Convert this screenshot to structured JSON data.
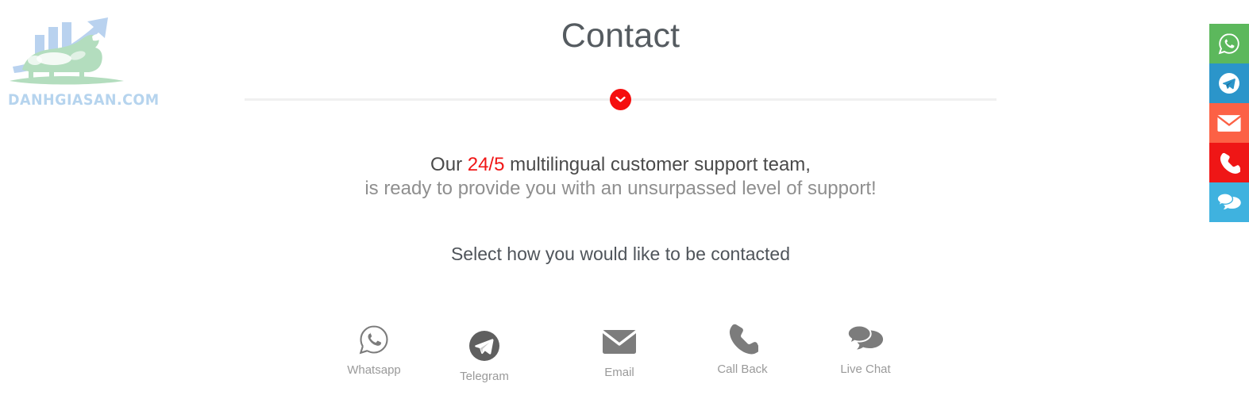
{
  "brand": {
    "logo_text": "DANHGIASAN.COM",
    "logo_icon": "bull-growth-chart-logo",
    "logo_bar_color": "#b9d2ef",
    "logo_bull_color": "#b3ddbe",
    "logo_text_color": "#b6d4ee"
  },
  "header": {
    "title": "Contact",
    "divider_badge_icon": "chevron-down-icon",
    "divider_badge_color": "#f50f0f",
    "divider_line_color": "#f0f0f0"
  },
  "intro": {
    "line1_prefix": "Our ",
    "line1_accent": "24/5",
    "line1_suffix": " multilingual customer support team,",
    "line2": "is ready to provide you with an unsurpassed level of support!",
    "accent_color": "#f01616"
  },
  "subheading": {
    "text": "Select how you would like to be contacted"
  },
  "methods": [
    {
      "label": "Whatsapp",
      "icon": "whatsapp-icon"
    },
    {
      "label": "Telegram",
      "icon": "telegram-icon"
    },
    {
      "label": "Email",
      "icon": "email-icon"
    },
    {
      "label": "Call Back",
      "icon": "phone-icon"
    },
    {
      "label": "Live Chat",
      "icon": "chat-bubbles-icon"
    }
  ],
  "float_bar": [
    {
      "name": "whatsapp",
      "icon": "whatsapp-icon",
      "color": "#5cb85c"
    },
    {
      "name": "telegram",
      "icon": "telegram-icon",
      "color": "#2b95ca"
    },
    {
      "name": "email",
      "icon": "email-icon",
      "color": "#fc6145"
    },
    {
      "name": "call",
      "icon": "phone-icon",
      "color": "#ef1616"
    },
    {
      "name": "chat",
      "icon": "chat-bubbles-icon",
      "color": "#3fb2df"
    }
  ]
}
